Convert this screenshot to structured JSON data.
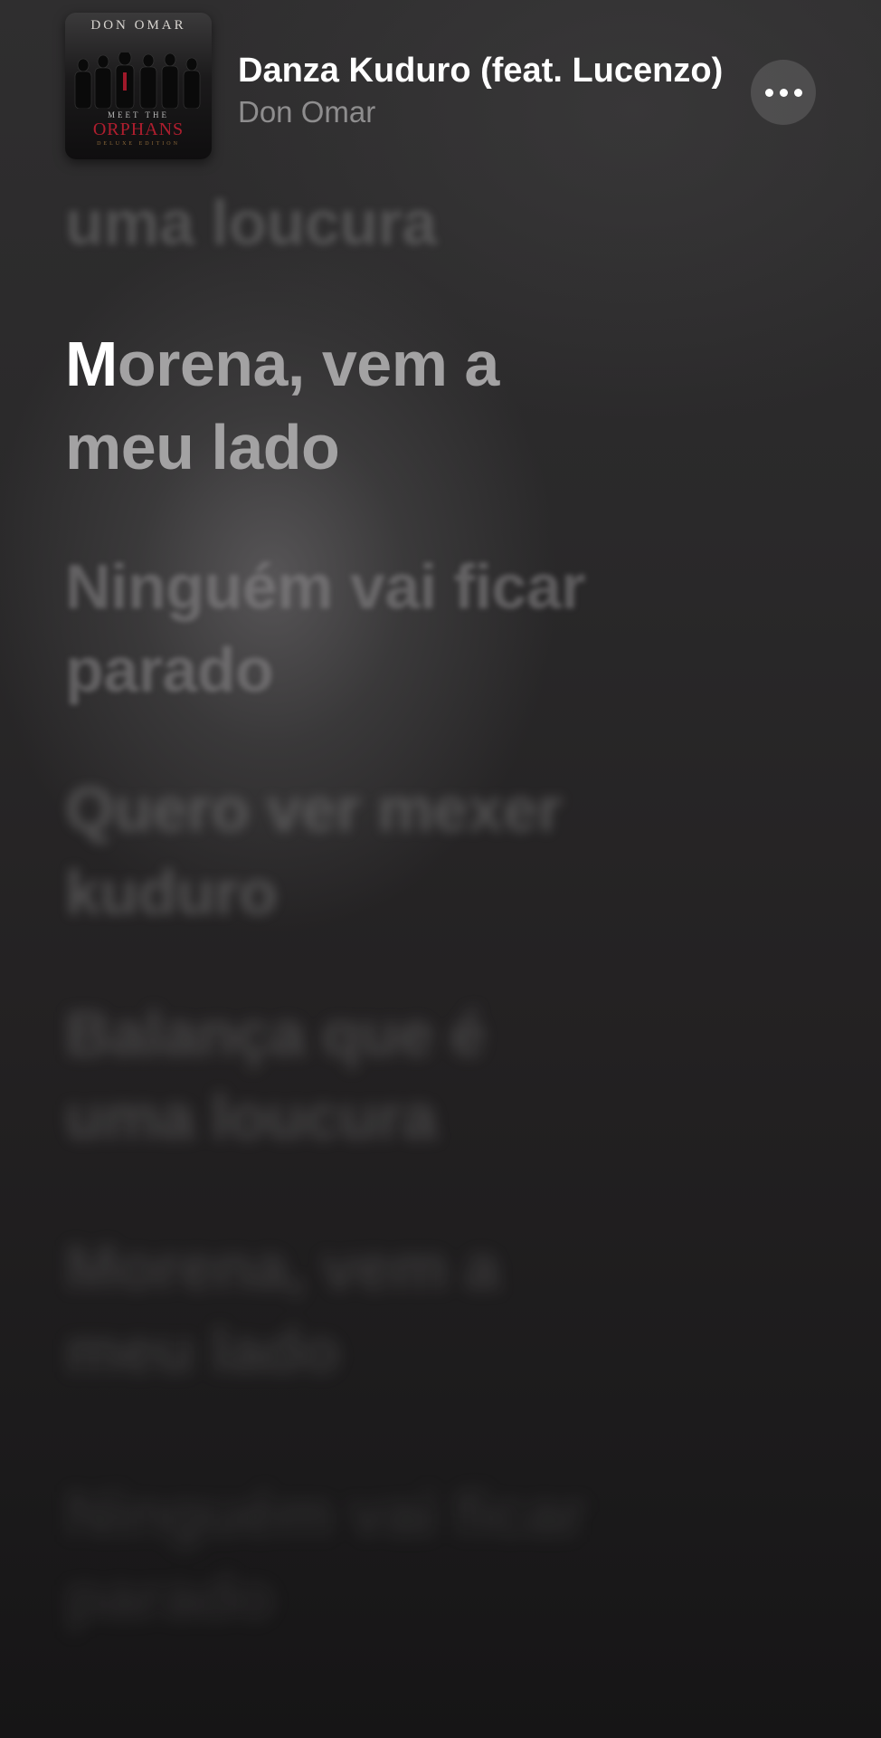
{
  "now_playing": {
    "title": "Danza Kuduro (feat. Lucenzo)",
    "artist": "Don Omar",
    "artwork": {
      "top_text": "DON OMAR",
      "sub_text": "MEET THE",
      "title_text": "ORPHANS",
      "edition_text": "DELUXE EDITION",
      "title_color": "#b01e2e"
    },
    "more_icon": "ellipsis-icon"
  },
  "lyrics": {
    "previous": "uma loucura",
    "active_first_letter": "M",
    "active_rest": "orena, vem a meu lado",
    "upcoming": [
      "Ninguém vai ficar parado",
      "Quero ver mexer kuduro",
      "Balança que é uma loucura",
      "Morena, vem a meu lado",
      "Ninguém vai ficar parado"
    ]
  }
}
